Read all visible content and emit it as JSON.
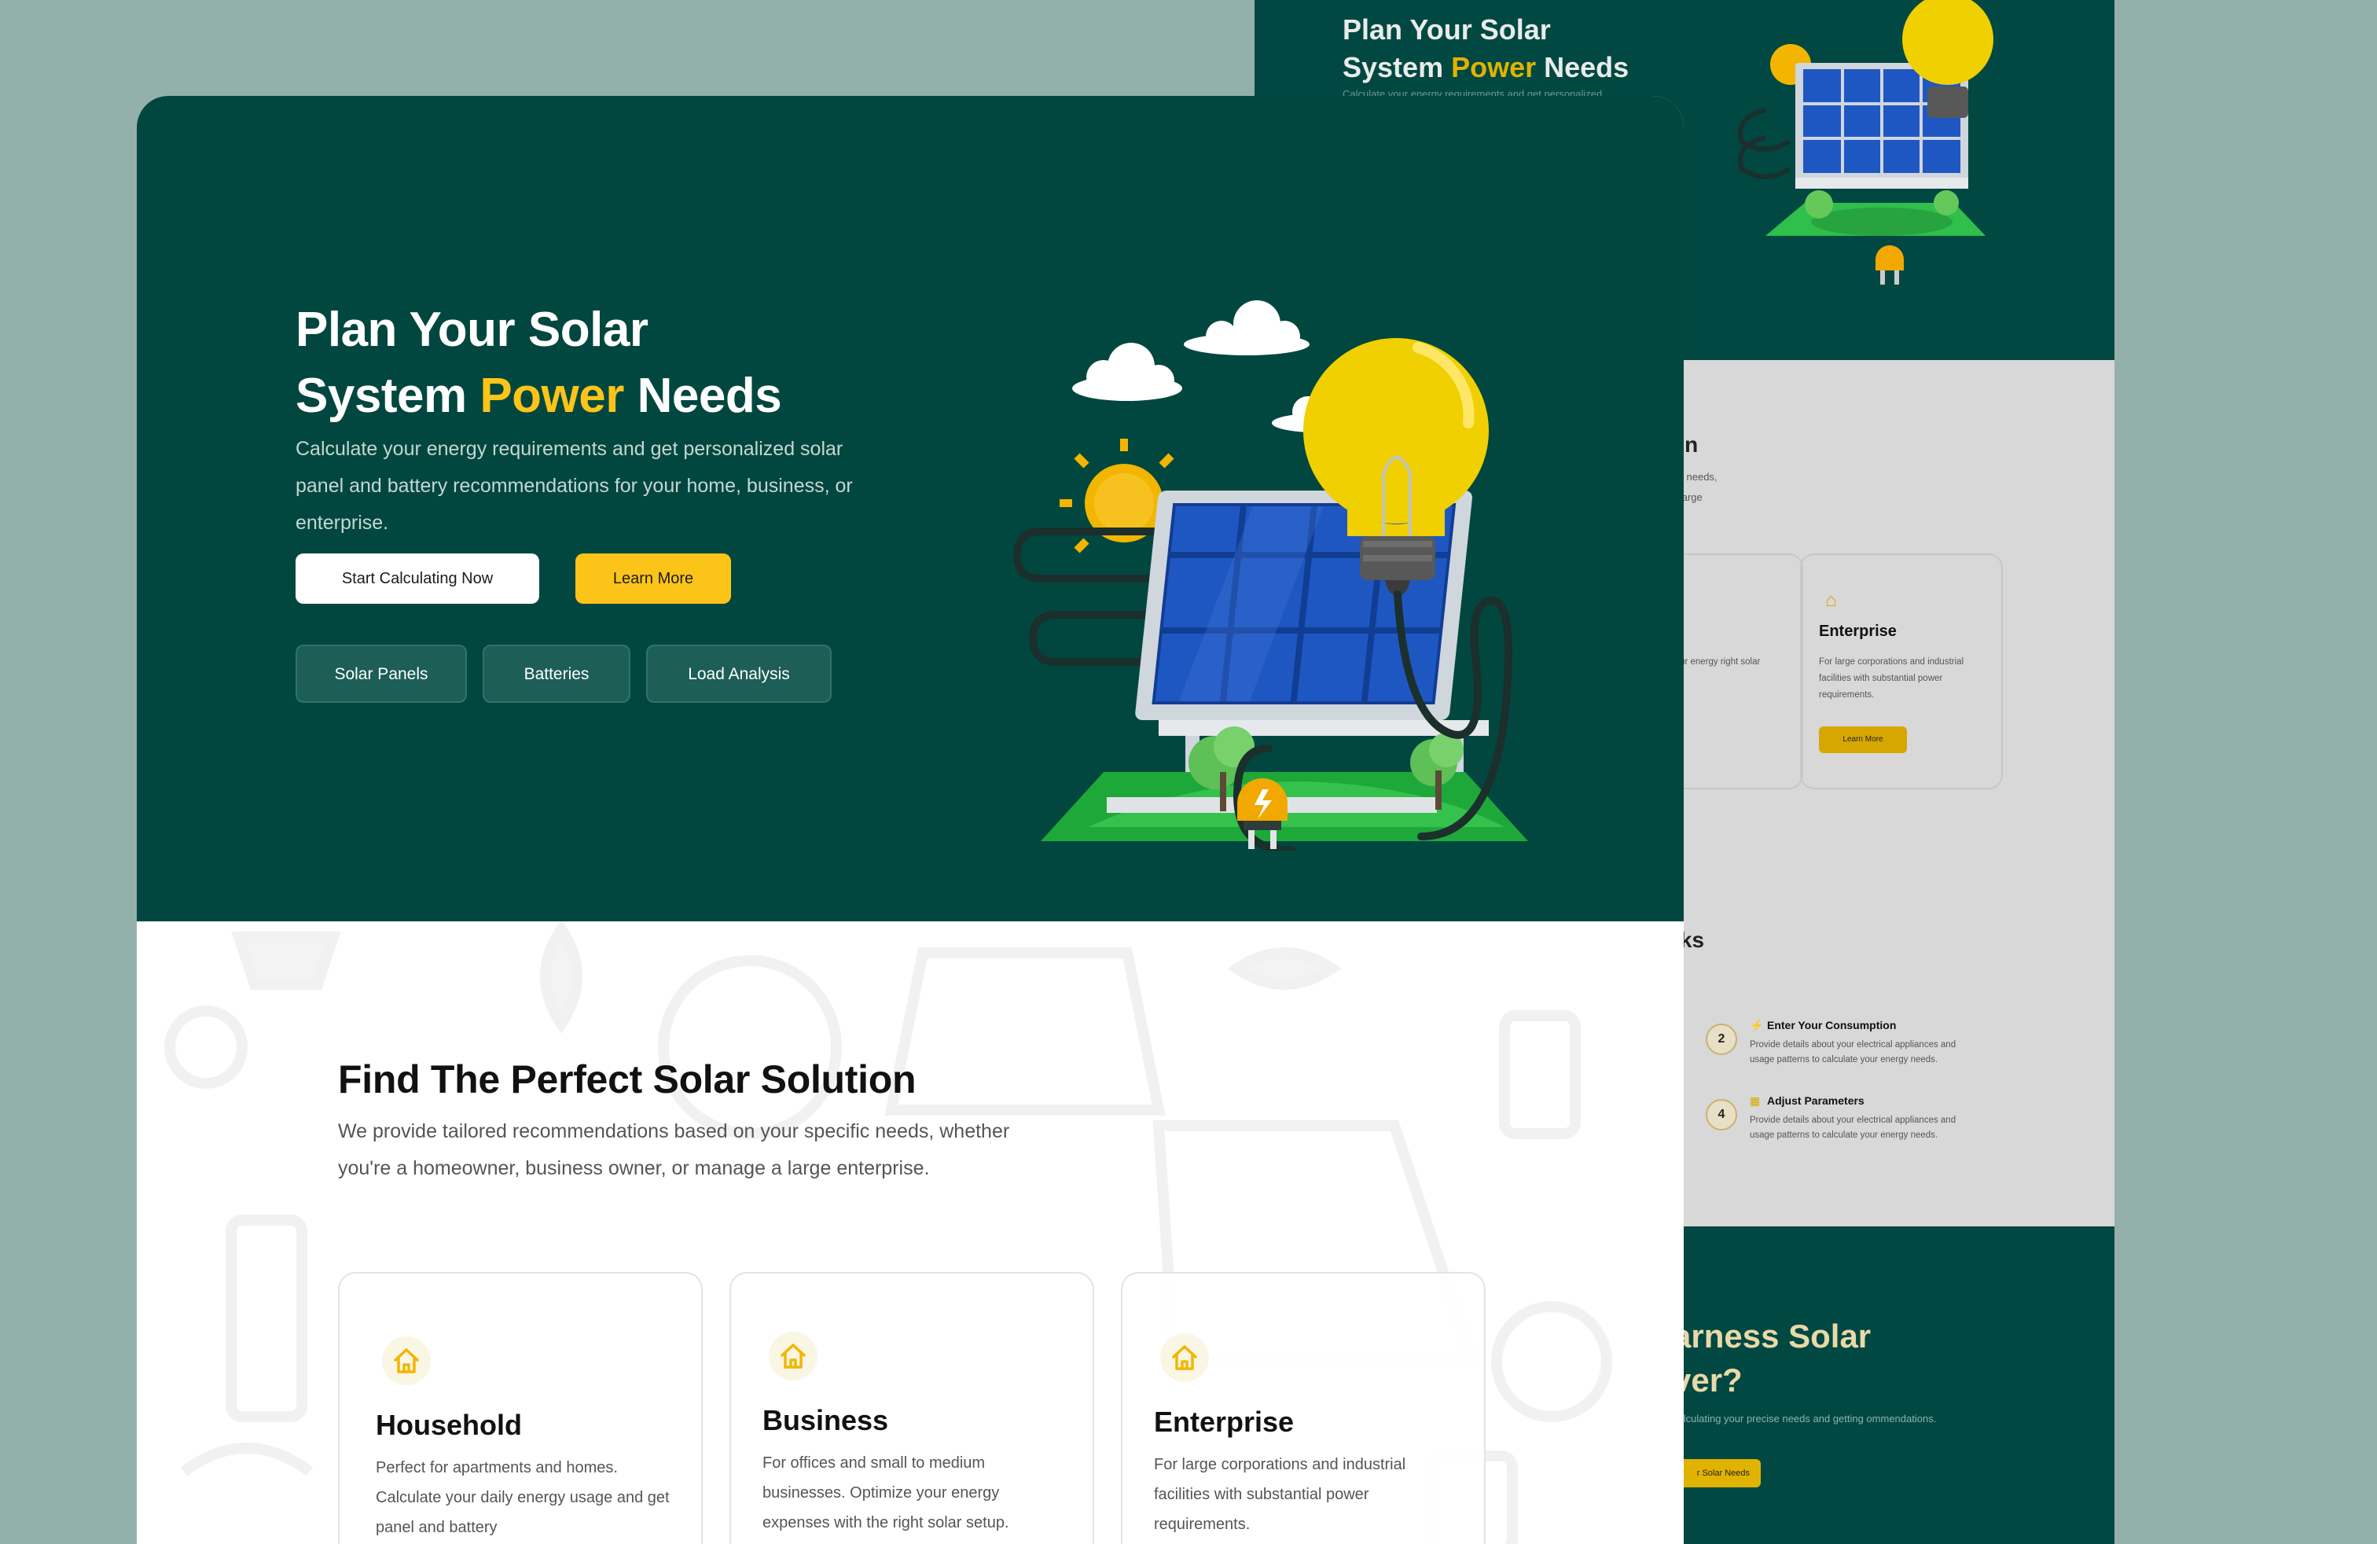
{
  "hero": {
    "title_line1": "Plan Your Solar",
    "title_line2_pre": "System ",
    "title_accent": "Power",
    "title_line2_post": " Needs",
    "subtitle": "Calculate your energy requirements and get personalized solar panel and battery recommendations for your home, business, or enterprise.",
    "primary_button": "Start Calculating Now",
    "secondary_button": "Learn More",
    "tags": [
      "Solar Panels",
      "Batteries",
      "Load Analysis"
    ]
  },
  "solutions": {
    "title": "Find The Perfect Solar Solution",
    "description": "We provide tailored recommendations based on your specific needs, whether you're a homeowner, business owner, or manage a large enterprise.",
    "cards": [
      {
        "icon": "house-icon",
        "title": "Household",
        "description": "Perfect for apartments and homes. Calculate your daily energy usage and get panel and battery"
      },
      {
        "icon": "house-icon",
        "title": "Business",
        "description": "For offices and small to medium businesses. Optimize your energy expenses with the right solar setup."
      },
      {
        "icon": "house-icon",
        "title": "Enterprise",
        "description": "For large corporations and industrial facilities with substantial power requirements."
      }
    ]
  },
  "background_preview": {
    "hero_title_line1": "Plan Your Solar",
    "hero_title_line2_pre": "System ",
    "hero_title_accent": "Power",
    "hero_title_line2_post": " Needs",
    "hero_subtitle_fragment": "Calculate your energy requirements and get personalized",
    "solutions_title_fragment": "on",
    "solutions_desc_fragment": "ific needs, a large",
    "business_card_desc_fragment": "all to medium ze your energy right solar setup.",
    "enterprise_card": {
      "title": "Enterprise",
      "description": "For large corporations and industrial facilities with substantial power requirements.",
      "button": "Learn More"
    },
    "how_title_fragment": "rks",
    "steps": [
      {
        "number": "2",
        "title": "Enter Your Consumption",
        "description": "Provide details about your electrical appliances and usage patterns to calculate your energy needs."
      },
      {
        "number": "4",
        "title": "Adjust Parameters",
        "description": "Provide details about your electrical appliances and usage patterns to calculate your energy needs."
      }
    ],
    "cta_title_fragment_1": "arness Solar",
    "cta_title_fragment_2": "ver?",
    "cta_subtitle_fragment": "calculating your precise needs and getting ommendations.",
    "cta_button_fragment": "r Solar Needs"
  },
  "colors": {
    "page_bg": "#94b0ab",
    "hero_bg": "#01473f",
    "accent_yellow": "#fcc419",
    "tag_bg": "#1d5e56",
    "panel_blue": "#1f57c2"
  }
}
